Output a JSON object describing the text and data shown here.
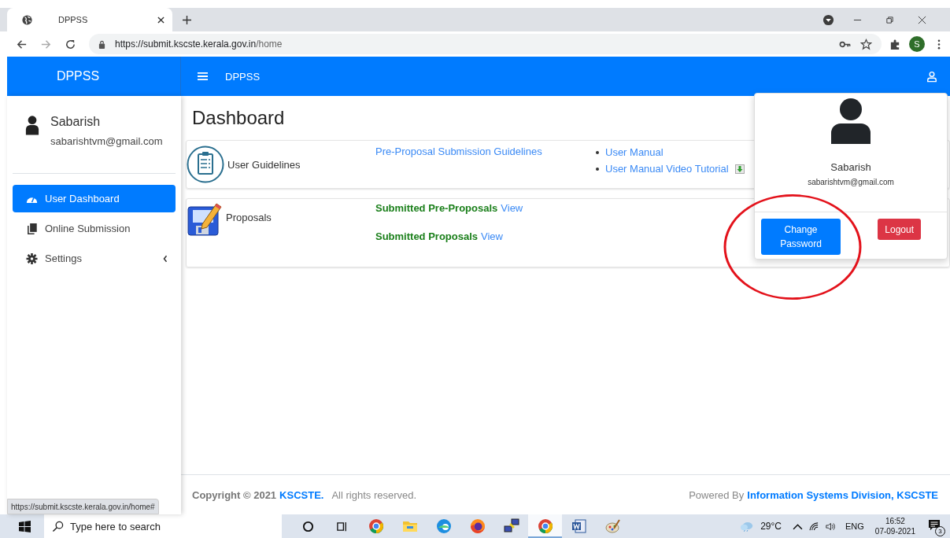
{
  "browser": {
    "tab_title": "DPPSS",
    "url_host": "https://submit.kscste.kerala.gov.in",
    "url_path": "/home",
    "avatar_letter": "S",
    "status_url": "https://submit.kscste.kerala.gov.in/home#"
  },
  "header": {
    "brand": "DPPSS",
    "title": "DPPSS"
  },
  "user": {
    "name": "Sabarish",
    "email": "sabarishtvm@gmail.com"
  },
  "sidebar": {
    "items": [
      {
        "label": "User Dashboard",
        "selected": true,
        "expandable": false
      },
      {
        "label": "Online Submission",
        "selected": false,
        "expandable": false
      },
      {
        "label": "Settings",
        "selected": false,
        "expandable": true
      }
    ]
  },
  "page": {
    "title": "Dashboard"
  },
  "guidelines": {
    "title": "User Guidelines",
    "link": "Pre-Proposal Submission Guidelines",
    "list": [
      {
        "text": "User Manual",
        "download": false
      },
      {
        "text": "User Manual Video Tutorial",
        "download": true
      }
    ]
  },
  "proposals": {
    "title": "Proposals",
    "rows": [
      {
        "label": "Submitted Pre-Proposals",
        "link": "View"
      },
      {
        "label": "Submitted Proposals",
        "link": "View"
      }
    ]
  },
  "dropdown": {
    "name": "Sabarish",
    "email": "sabarishtvm@gmail.com",
    "buttons": [
      {
        "label": "Change Password",
        "kind": "primary"
      },
      {
        "label": "Logout",
        "kind": "danger"
      }
    ],
    "annotated": true
  },
  "footer": {
    "copyright": "Copyright © 2021",
    "org": "KSCSTE.",
    "rights": "All rights reserved.",
    "powered": "Powered By",
    "division": "Information Systems Division, KSCSTE"
  },
  "taskbar": {
    "search_placeholder": "Type here to search",
    "apps": [
      {
        "active": false
      },
      {
        "active": false
      },
      {
        "active": false
      },
      {
        "active": false
      },
      {
        "active": false
      },
      {
        "active": true
      },
      {
        "active": false
      },
      {
        "active": false
      }
    ],
    "temperature": "29°C",
    "language": "ENG",
    "time": "16:52",
    "date": "07-09-2021",
    "notifications": "3"
  }
}
